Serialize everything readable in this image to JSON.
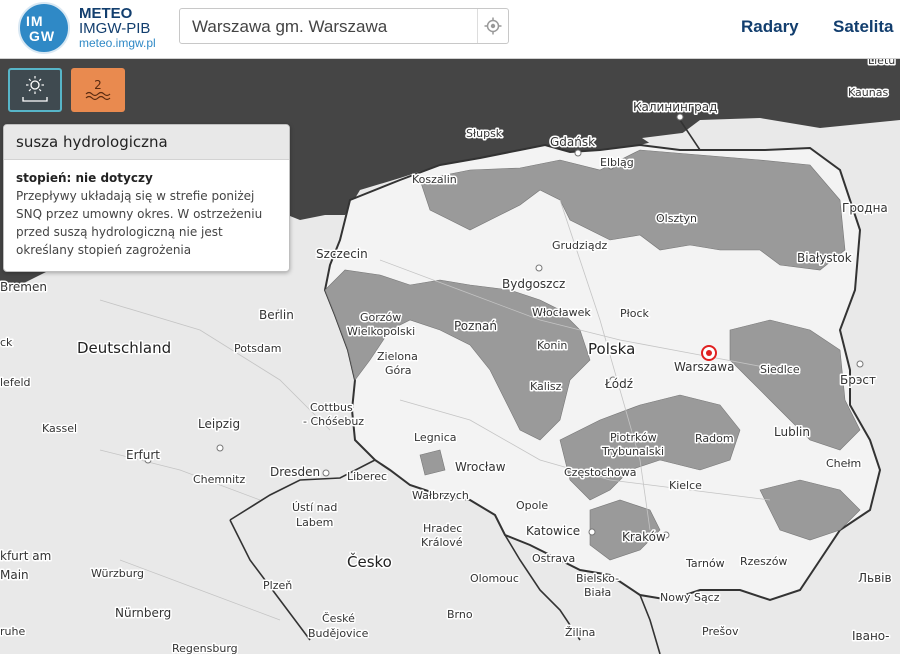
{
  "header": {
    "logo": {
      "line1": "IM",
      "line2": "GW"
    },
    "brand_name": "METEO",
    "brand_org": "IMGW-PIB",
    "brand_url": "meteo.imgw.pl",
    "search": {
      "value": "Warszawa gm. Warszawa"
    },
    "nav": [
      {
        "label": "Radary"
      },
      {
        "label": "Satelita"
      }
    ]
  },
  "controls": {
    "sun_icon": "sun-icon",
    "level_badge": {
      "value": "2",
      "icon": "water-waves-icon"
    }
  },
  "popup": {
    "title": "susza hydrologiczna",
    "level_label": "stopień: nie dotyczy",
    "description": "Przepływy układają się w strefie poniżej SNQ przez umowny okres. W ostrzeżeniu przed suszą hydrologiczną nie jest określany stopień zagrożenia"
  },
  "map": {
    "colors": {
      "sea": "#454545",
      "land": "#e9e9e9",
      "poland": "#f3f3f3",
      "drought": "#9a9a9a",
      "marker": "#e02020"
    },
    "labels": {
      "kaliningrad": "Калининград",
      "kaunas": "Kaunas",
      "lietu": "Lietu",
      "grodna": "Гродна",
      "slupsk": "Słupsk",
      "gdansk": "Gdańsk",
      "elblag": "Elbląg",
      "koszalin": "Koszalin",
      "olsztyn": "Olsztyn",
      "grudziadz": "Grudziądz",
      "szczecin": "Szczecin",
      "bialystok": "Białystok",
      "bydgoszcz": "Bydgoszcz",
      "bremen": "Bremen",
      "berlin": "Berlin",
      "gorzow": "Gorzów",
      "wielkopolski": "Wielkopolski",
      "poznan": "Poznań",
      "wloclawek": "Włocławek",
      "plock": "Płock",
      "deutschland": "Deutschland",
      "potsdam": "Potsdam",
      "konin": "Konin",
      "polska": "Polska",
      "warszawa": "Warszawa",
      "siedlce": "Siedlce",
      "zielona": "Zielona",
      "gora": "Góra",
      "lodz": "Łódź",
      "brest": "Брэст",
      "kalisz": "Kalisz",
      "cottbus": "Cottbus",
      "chosebuz": "- Chóśebuz",
      "kassel": "Kassel",
      "leipzig": "Leipzig",
      "legnica": "Legnica",
      "piotrkow": "Piotrków",
      "trybunalski": "Trybunalski",
      "radom": "Radom",
      "lublin": "Lublin",
      "erfurt": "Erfurt",
      "dresden": "Dresden",
      "wroclaw": "Wrocław",
      "chelm": "Chełm",
      "czestochowa": "Częstochowa",
      "chemnitz": "Chemnitz",
      "liberec": "Liberec",
      "kielce": "Kielce",
      "walbrzych": "Wałbrzych",
      "usti": "Ústí nad",
      "labem": "Labem",
      "opole": "Opole",
      "hradec": "Hradec",
      "kralove": "Králové",
      "katowice": "Katowice",
      "krakow": "Kraków",
      "frankfurt": "kfurt am",
      "main": "Main",
      "cesko": "Česko",
      "ostrava": "Ostrava",
      "tarnow": "Tarnów",
      "rzeszow": "Rzeszów",
      "wurzburg": "Würzburg",
      "plzen": "Plzeň",
      "olomouc": "Olomouc",
      "bielsko": "Bielsko-",
      "biala": "Biała",
      "lviv": "Львів",
      "nurnberg": "Nürnberg",
      "brno": "Brno",
      "nowysacz": "Nowy Sącz",
      "ceske": "České",
      "budejovice": "Budějovice",
      "zilina": "Žilina",
      "presov": "Prešov",
      "ivano": "Івано-",
      "regensburg": "Regensburg",
      "ruhe": "ruhe",
      "feld": "lefeld",
      "ck": "ck"
    }
  }
}
